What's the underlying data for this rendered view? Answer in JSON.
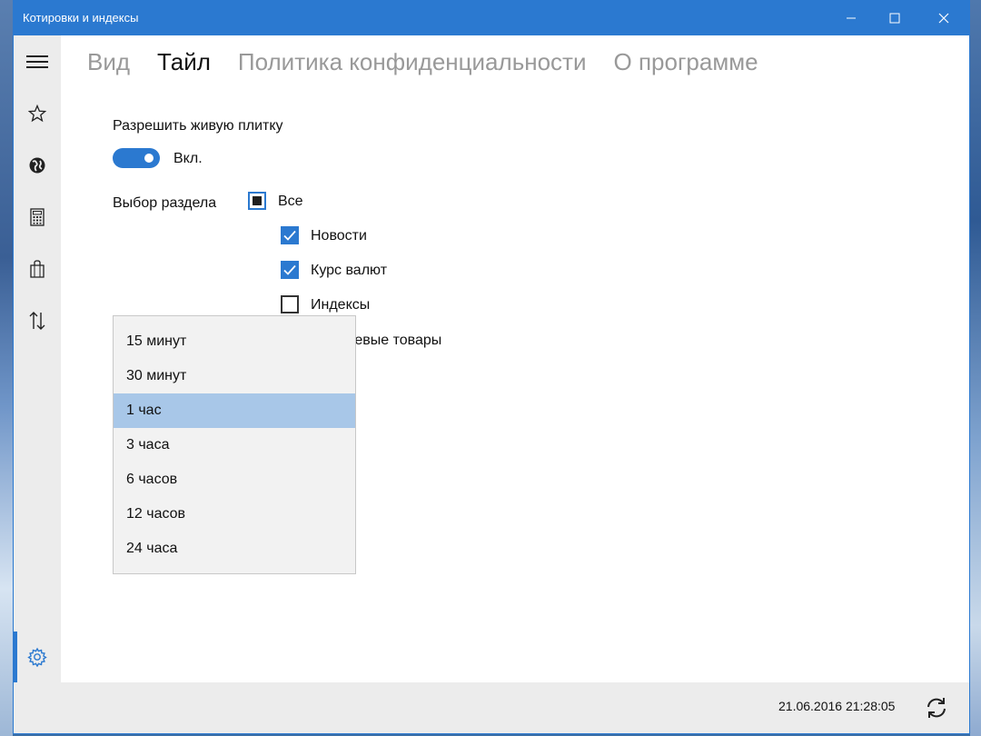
{
  "window": {
    "title": "Котировки и индексы"
  },
  "tabs": [
    {
      "label": "Вид",
      "active": false
    },
    {
      "label": "Тайл",
      "active": true
    },
    {
      "label": "Политика конфиденциальности",
      "active": false
    },
    {
      "label": "О программе",
      "active": false
    }
  ],
  "live_tile": {
    "label": "Разрешить живую плитку",
    "toggle_state": "Вкл."
  },
  "section": {
    "label": "Выбор раздела",
    "items": [
      {
        "label": "Все",
        "state": "indeterminate"
      },
      {
        "label": "Новости",
        "state": "checked"
      },
      {
        "label": "Курс валют",
        "state": "checked"
      },
      {
        "label": "Индексы",
        "state": "unchecked"
      },
      {
        "label": "...евые товары",
        "state": "hidden"
      }
    ]
  },
  "dropdown": {
    "options": [
      "15 минут",
      "30 минут",
      "1 час",
      "3 часа",
      "6 часов",
      "12 часов",
      "24 часа"
    ],
    "selected": "1 час"
  },
  "status": {
    "timestamp": "21.06.2016 21:28:05"
  },
  "colors": {
    "accent": "#2b79d0",
    "selection": "#a8c7e8",
    "sidebar": "#ececec"
  }
}
